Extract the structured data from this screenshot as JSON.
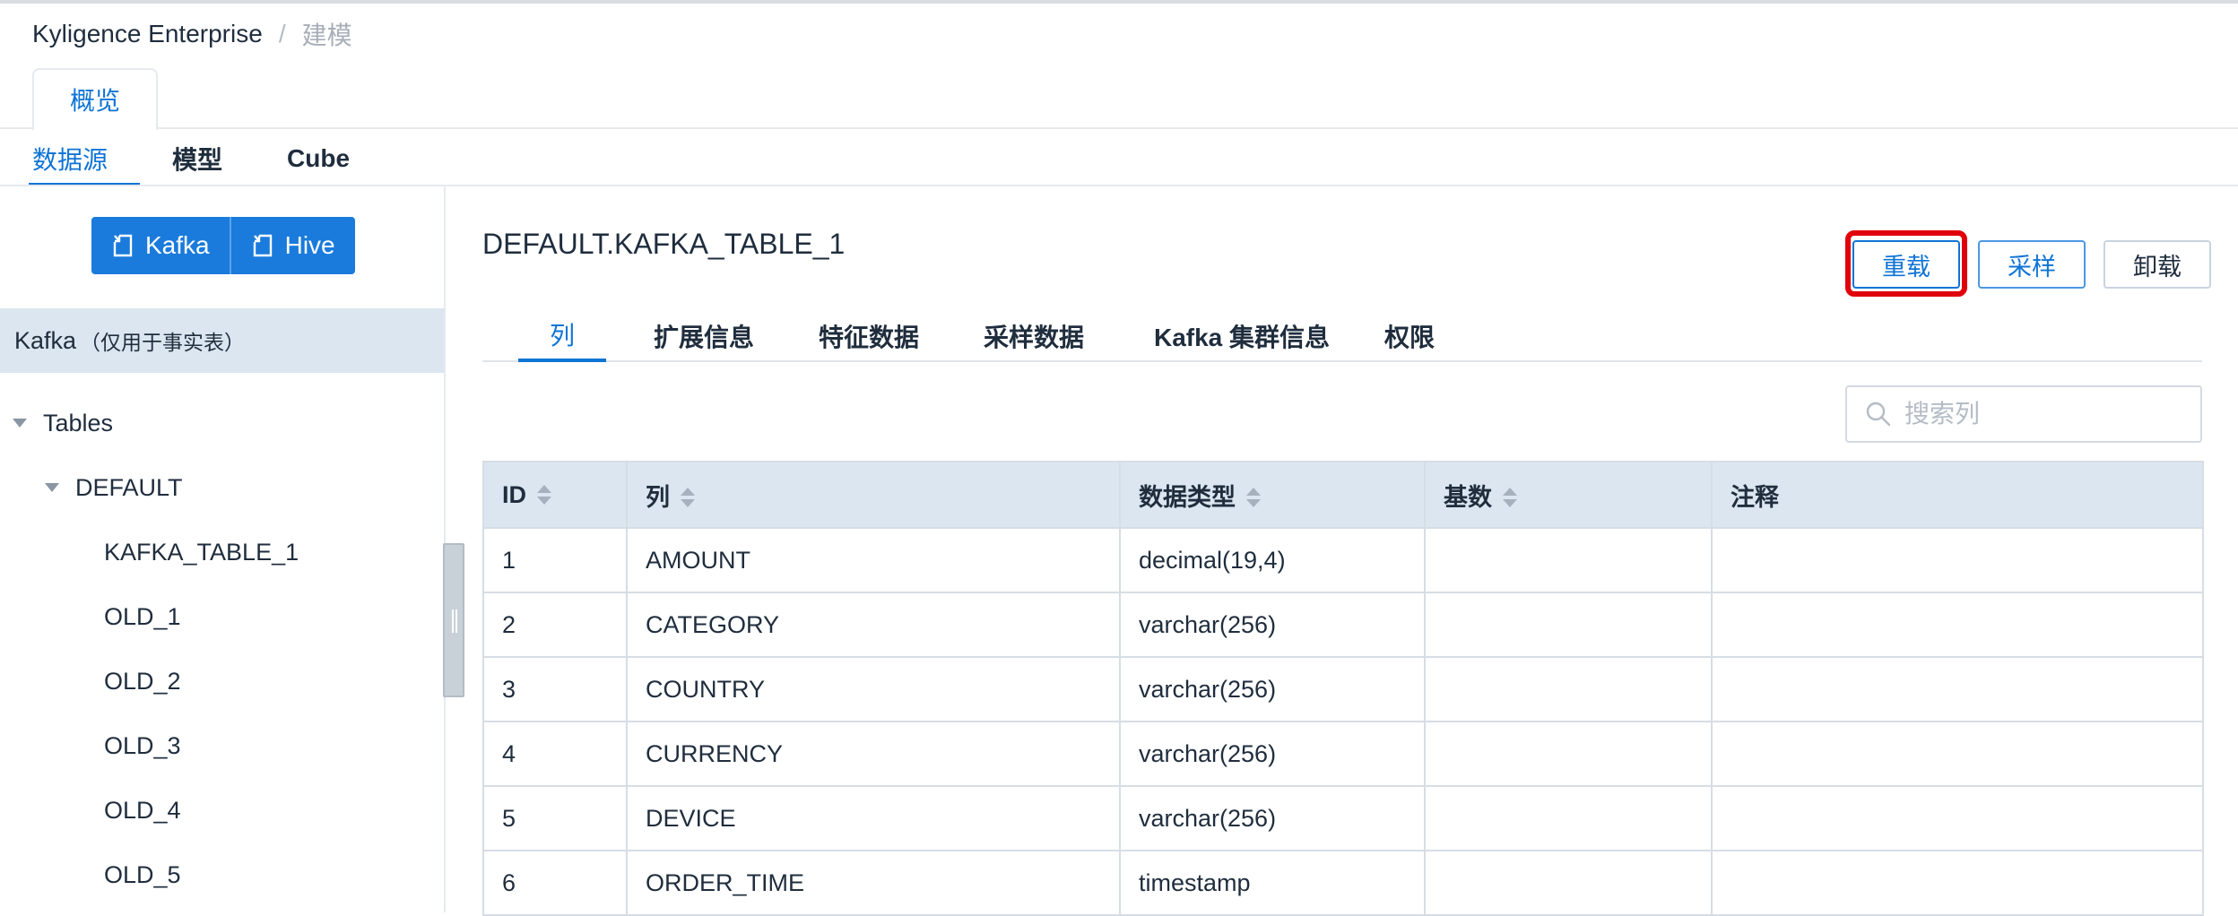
{
  "breadcrumb": {
    "app": "Kyligence Enterprise",
    "separator": "/",
    "current": "建模"
  },
  "page_tab": {
    "label": "概览"
  },
  "subnav": {
    "items": [
      "数据源",
      "模型",
      "Cube"
    ],
    "active": "数据源"
  },
  "left_panel": {
    "source_buttons": [
      {
        "label": "Kafka",
        "icon": "load-table-icon"
      },
      {
        "label": "Hive",
        "icon": "load-table-icon"
      }
    ],
    "kafka_header": {
      "label": "Kafka",
      "note": "（仅用于事实表）"
    },
    "tree": {
      "root": "Tables",
      "database": "DEFAULT",
      "tables": [
        "KAFKA_TABLE_1",
        "OLD_1",
        "OLD_2",
        "OLD_3",
        "OLD_4",
        "OLD_5"
      ]
    }
  },
  "detail": {
    "table_name": "DEFAULT.KAFKA_TABLE_1",
    "actions": {
      "reload": "重载",
      "sample": "采样",
      "unload": "卸载"
    },
    "tabs": [
      "列",
      "扩展信息",
      "特征数据",
      "采样数据",
      "Kafka 集群信息",
      "权限"
    ],
    "active_tab": "列",
    "search": {
      "placeholder": "搜索列",
      "value": ""
    },
    "columns_table": {
      "headers": [
        "ID",
        "列",
        "数据类型",
        "基数",
        "注释"
      ],
      "rows": [
        [
          "1",
          "AMOUNT",
          "decimal(19,4)",
          "",
          ""
        ],
        [
          "2",
          "CATEGORY",
          "varchar(256)",
          "",
          ""
        ],
        [
          "3",
          "COUNTRY",
          "varchar(256)",
          "",
          ""
        ],
        [
          "4",
          "CURRENCY",
          "varchar(256)",
          "",
          ""
        ],
        [
          "5",
          "DEVICE",
          "varchar(256)",
          "",
          ""
        ],
        [
          "6",
          "ORDER_TIME",
          "timestamp",
          "",
          ""
        ]
      ]
    }
  },
  "colors": {
    "accent": "#0f74d6",
    "highlight": "#e0000c",
    "header_bg": "#dbe6f0"
  }
}
